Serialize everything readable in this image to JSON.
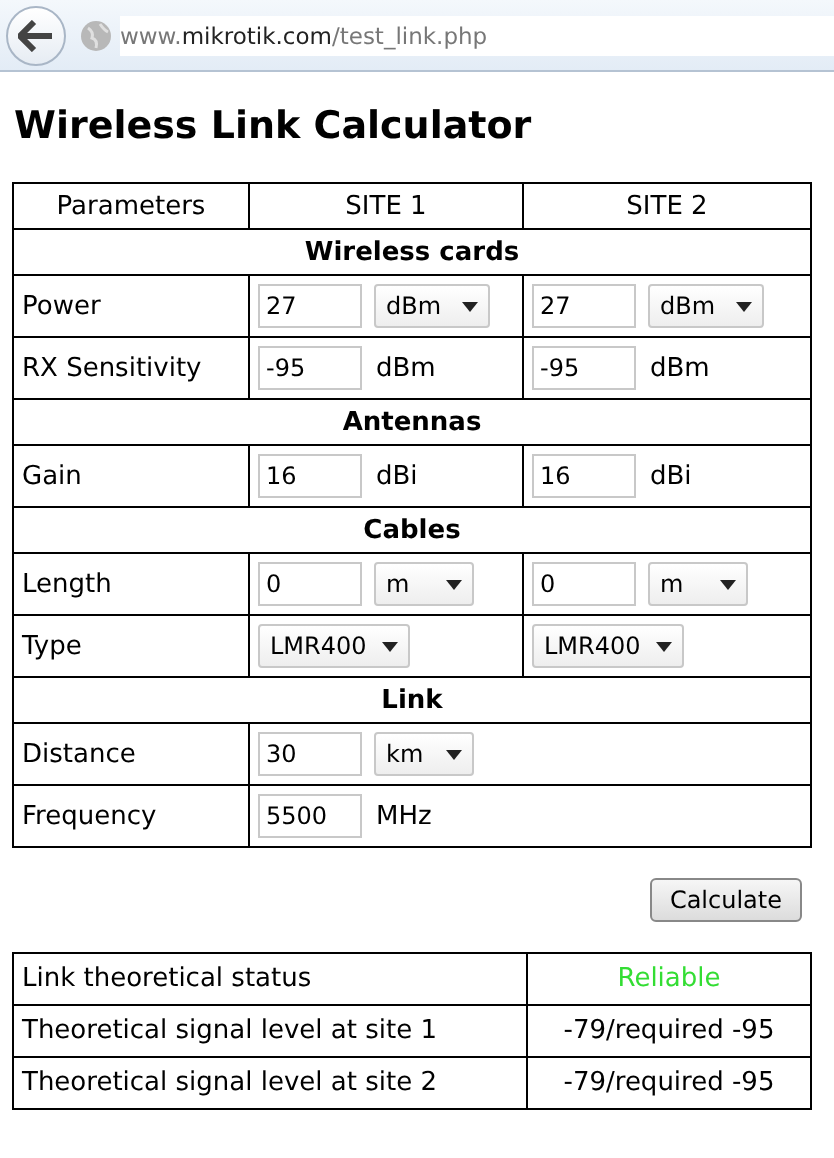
{
  "browser": {
    "url": {
      "prefix": "www.",
      "domain": "mikrotik.com",
      "path": "/test_link.php"
    }
  },
  "title": "Wireless Link Calculator",
  "table": {
    "columns": [
      "Parameters",
      "SITE 1",
      "SITE 2"
    ],
    "rows": [
      {
        "kind": "section",
        "label": "Wireless cards"
      },
      {
        "kind": "param",
        "label": "Power",
        "site_1": [
          {
            "kind": "input",
            "value": "27"
          },
          {
            "kind": "select",
            "value": "dBm"
          }
        ],
        "site_2": [
          {
            "kind": "input",
            "value": "27"
          },
          {
            "kind": "select",
            "value": "dBm"
          }
        ]
      },
      {
        "kind": "param",
        "label": "RX Sensitivity",
        "site_1": [
          {
            "kind": "input",
            "value": "-95"
          },
          {
            "kind": "unit",
            "text": "dBm"
          }
        ],
        "site_2": [
          {
            "kind": "input",
            "value": "-95"
          },
          {
            "kind": "unit",
            "text": "dBm"
          }
        ]
      },
      {
        "kind": "section",
        "label": "Antennas"
      },
      {
        "kind": "param",
        "label": "Gain",
        "site_1": [
          {
            "kind": "input",
            "value": "16"
          },
          {
            "kind": "unit",
            "text": "dBi"
          }
        ],
        "site_2": [
          {
            "kind": "input",
            "value": "16"
          },
          {
            "kind": "unit",
            "text": "dBi"
          }
        ]
      },
      {
        "kind": "section",
        "label": "Cables"
      },
      {
        "kind": "param",
        "label": "Length",
        "site_1": [
          {
            "kind": "input",
            "value": "0"
          },
          {
            "kind": "select",
            "value": "m"
          }
        ],
        "site_2": [
          {
            "kind": "input",
            "value": "0"
          },
          {
            "kind": "select",
            "value": "m"
          }
        ]
      },
      {
        "kind": "param",
        "label": "Type",
        "site_1": [
          {
            "kind": "select",
            "value": "LMR400"
          }
        ],
        "site_2": [
          {
            "kind": "select",
            "value": "LMR400"
          }
        ]
      },
      {
        "kind": "section",
        "label": "Link"
      },
      {
        "kind": "param",
        "label": "Distance",
        "site_1": [
          {
            "kind": "input",
            "value": "30"
          },
          {
            "kind": "select",
            "value": "km"
          }
        ]
      },
      {
        "kind": "param",
        "label": "Frequency",
        "site_1": [
          {
            "kind": "input",
            "value": "5500"
          },
          {
            "kind": "unit",
            "text": "MHz"
          }
        ]
      }
    ]
  },
  "calculate_button": "Calculate",
  "results": [
    {
      "label": "Link theoretical status",
      "value": "Reliable",
      "color": "#33dd33"
    },
    {
      "label": "Theoretical signal level at site 1",
      "value": "-79/required -95"
    },
    {
      "label": "Theoretical signal level at site 2",
      "value": "-79/required -95"
    }
  ]
}
